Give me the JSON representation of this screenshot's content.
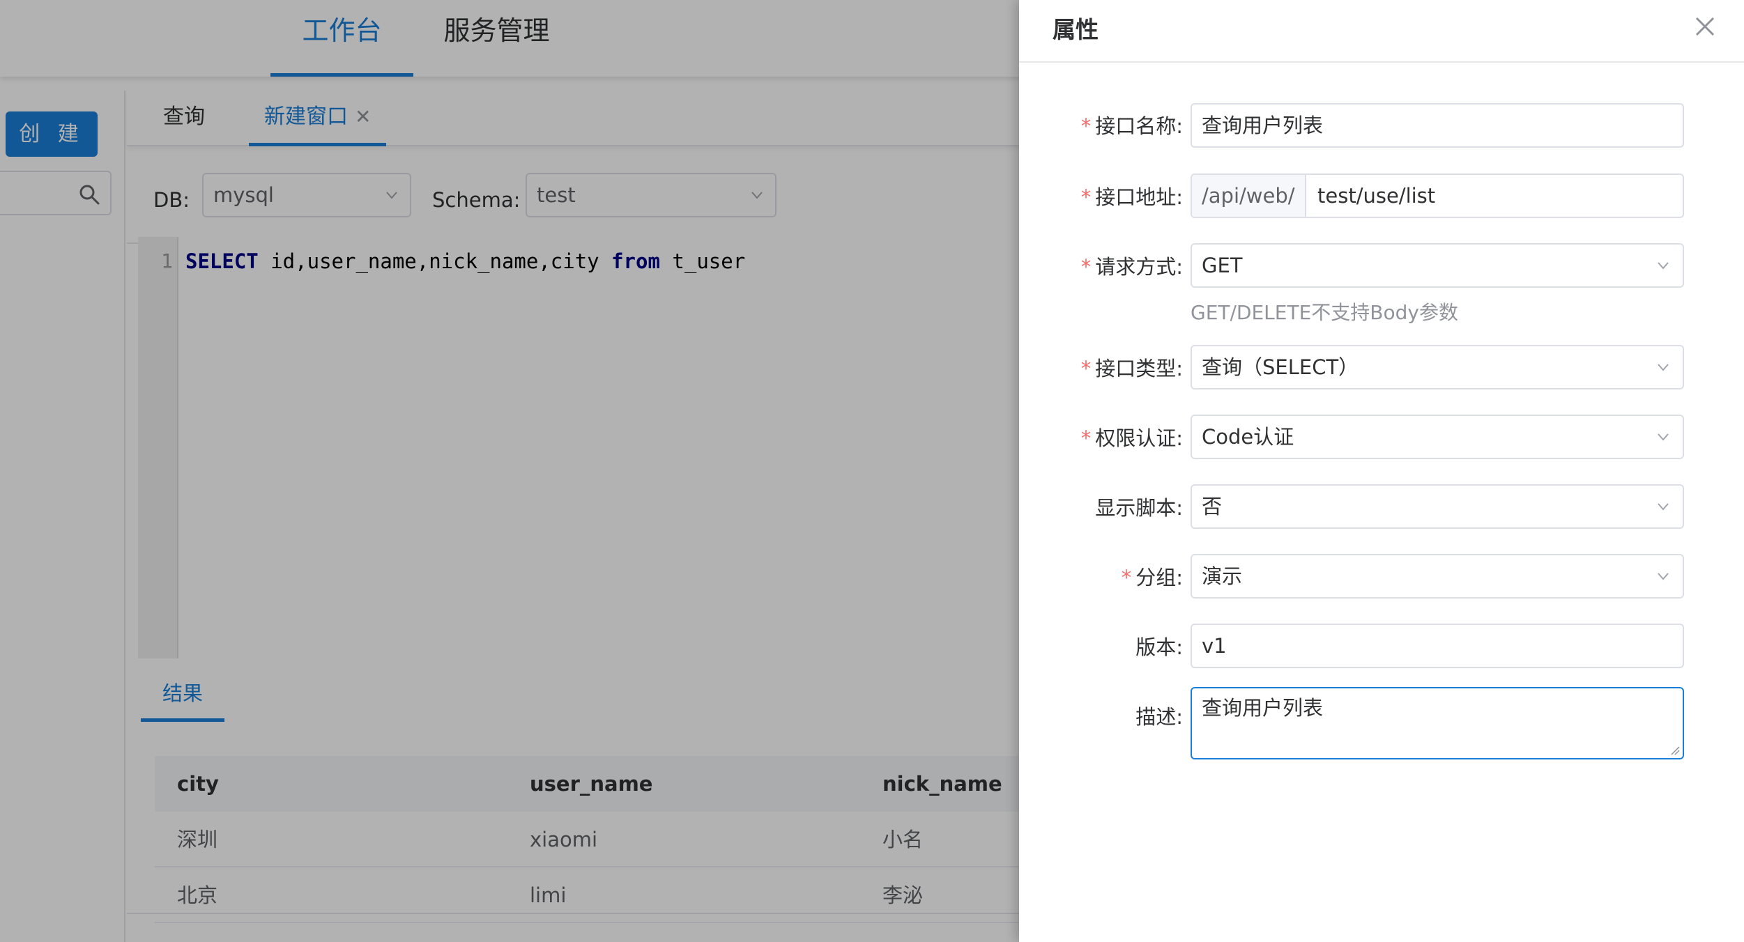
{
  "header": {
    "nav": [
      {
        "label": "工作台",
        "active": true
      },
      {
        "label": "服务管理",
        "active": false
      }
    ]
  },
  "sidebar": {
    "create_label": "创 建",
    "search_icon": "search-icon"
  },
  "tabs": [
    {
      "label": "查询"
    },
    {
      "label": "新建窗口",
      "close_icon": "close-icon"
    }
  ],
  "toolbar": {
    "db_label": "DB:",
    "db_value": "mysql",
    "schema_label": "Schema:",
    "schema_value": "test"
  },
  "editor": {
    "line_number": "1",
    "code_kw1": "SELECT",
    "code_mid": " id,user_name,nick_name,city ",
    "code_kw2": "from",
    "code_end": " t_user"
  },
  "results": {
    "tab_label": "结果",
    "columns": [
      "city",
      "user_name",
      "nick_name"
    ],
    "rows": [
      [
        "深圳",
        "xiaomi",
        "小名"
      ],
      [
        "北京",
        "limi",
        "李泌"
      ]
    ]
  },
  "drawer": {
    "title": "属性",
    "close_icon": "close-icon",
    "fields": {
      "name": {
        "label": "接口名称:",
        "required": "*",
        "value": "查询用户列表"
      },
      "path": {
        "label": "接口地址:",
        "required": "*",
        "prefix": "/api/web/",
        "value": "test/use/list"
      },
      "method": {
        "label": "请求方式:",
        "required": "*",
        "value": "GET",
        "hint": "GET/DELETE不支持Body参数"
      },
      "type": {
        "label": "接口类型:",
        "required": "*",
        "value": "查询（SELECT）"
      },
      "auth": {
        "label": "权限认证:",
        "required": "*",
        "value": "Code认证"
      },
      "show_script": {
        "label": "显示脚本:",
        "value": "否"
      },
      "group": {
        "label": "分组:",
        "required": "*",
        "value": "演示"
      },
      "version": {
        "label": "版本:",
        "value": "v1"
      },
      "description": {
        "label": "描述:",
        "value": "查询用户列表"
      }
    }
  },
  "colors": {
    "accent": "#1a7fd8",
    "required": "#f56c6c",
    "keyword": "#000088"
  }
}
